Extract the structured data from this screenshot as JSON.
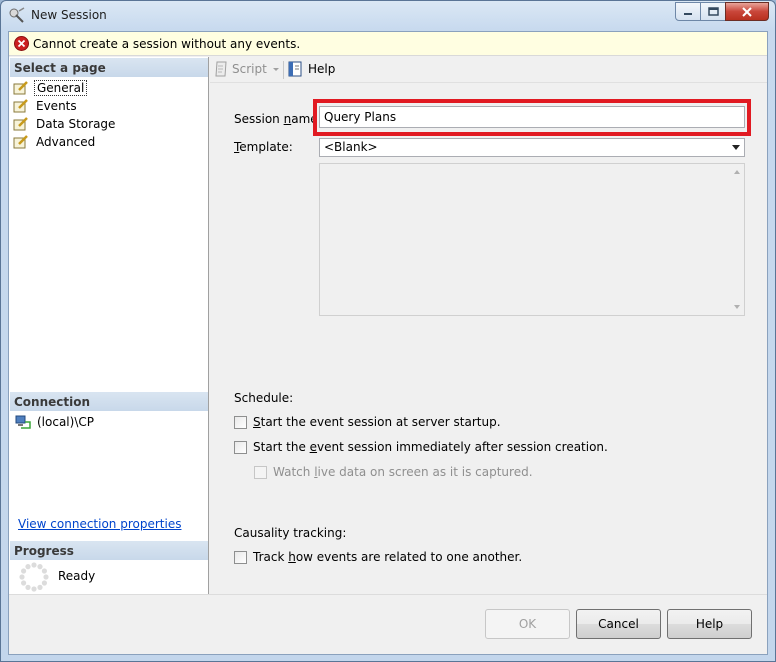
{
  "window": {
    "title": "New Session",
    "caption_buttons": [
      "minimize",
      "maximize",
      "close"
    ]
  },
  "error_bar": {
    "message": "Cannot create a session without any events."
  },
  "left_pane": {
    "select_page_header": "Select a page",
    "pages": [
      {
        "label": "General",
        "selected": true
      },
      {
        "label": "Events",
        "selected": false
      },
      {
        "label": "Data Storage",
        "selected": false
      },
      {
        "label": "Advanced",
        "selected": false
      }
    ],
    "connection_header": "Connection",
    "connection_name": "(local)\\CP",
    "view_connection_link": "View connection properties",
    "progress_header": "Progress",
    "progress_status": "Ready"
  },
  "toolbar": {
    "script_label": "Script",
    "help_label": "Help"
  },
  "form": {
    "session_name_label": "Session name:",
    "session_name_value": "Query Plans",
    "template_label": "Template:",
    "template_value": "<Blank>",
    "schedule_label": "Schedule:",
    "start_at_startup": "Start the event session at server startup.",
    "start_immediately": "Start the event session immediately after session creation.",
    "watch_live": "Watch live data on screen as it is captured.",
    "causality_label": "Causality tracking:",
    "track_events": "Track how events are related to one another."
  },
  "buttons": {
    "ok": "OK",
    "cancel": "Cancel",
    "help": "Help"
  },
  "colors": {
    "highlight": "#e11a22",
    "error_bar_bg": "#fffee1",
    "link": "#0044cc"
  }
}
